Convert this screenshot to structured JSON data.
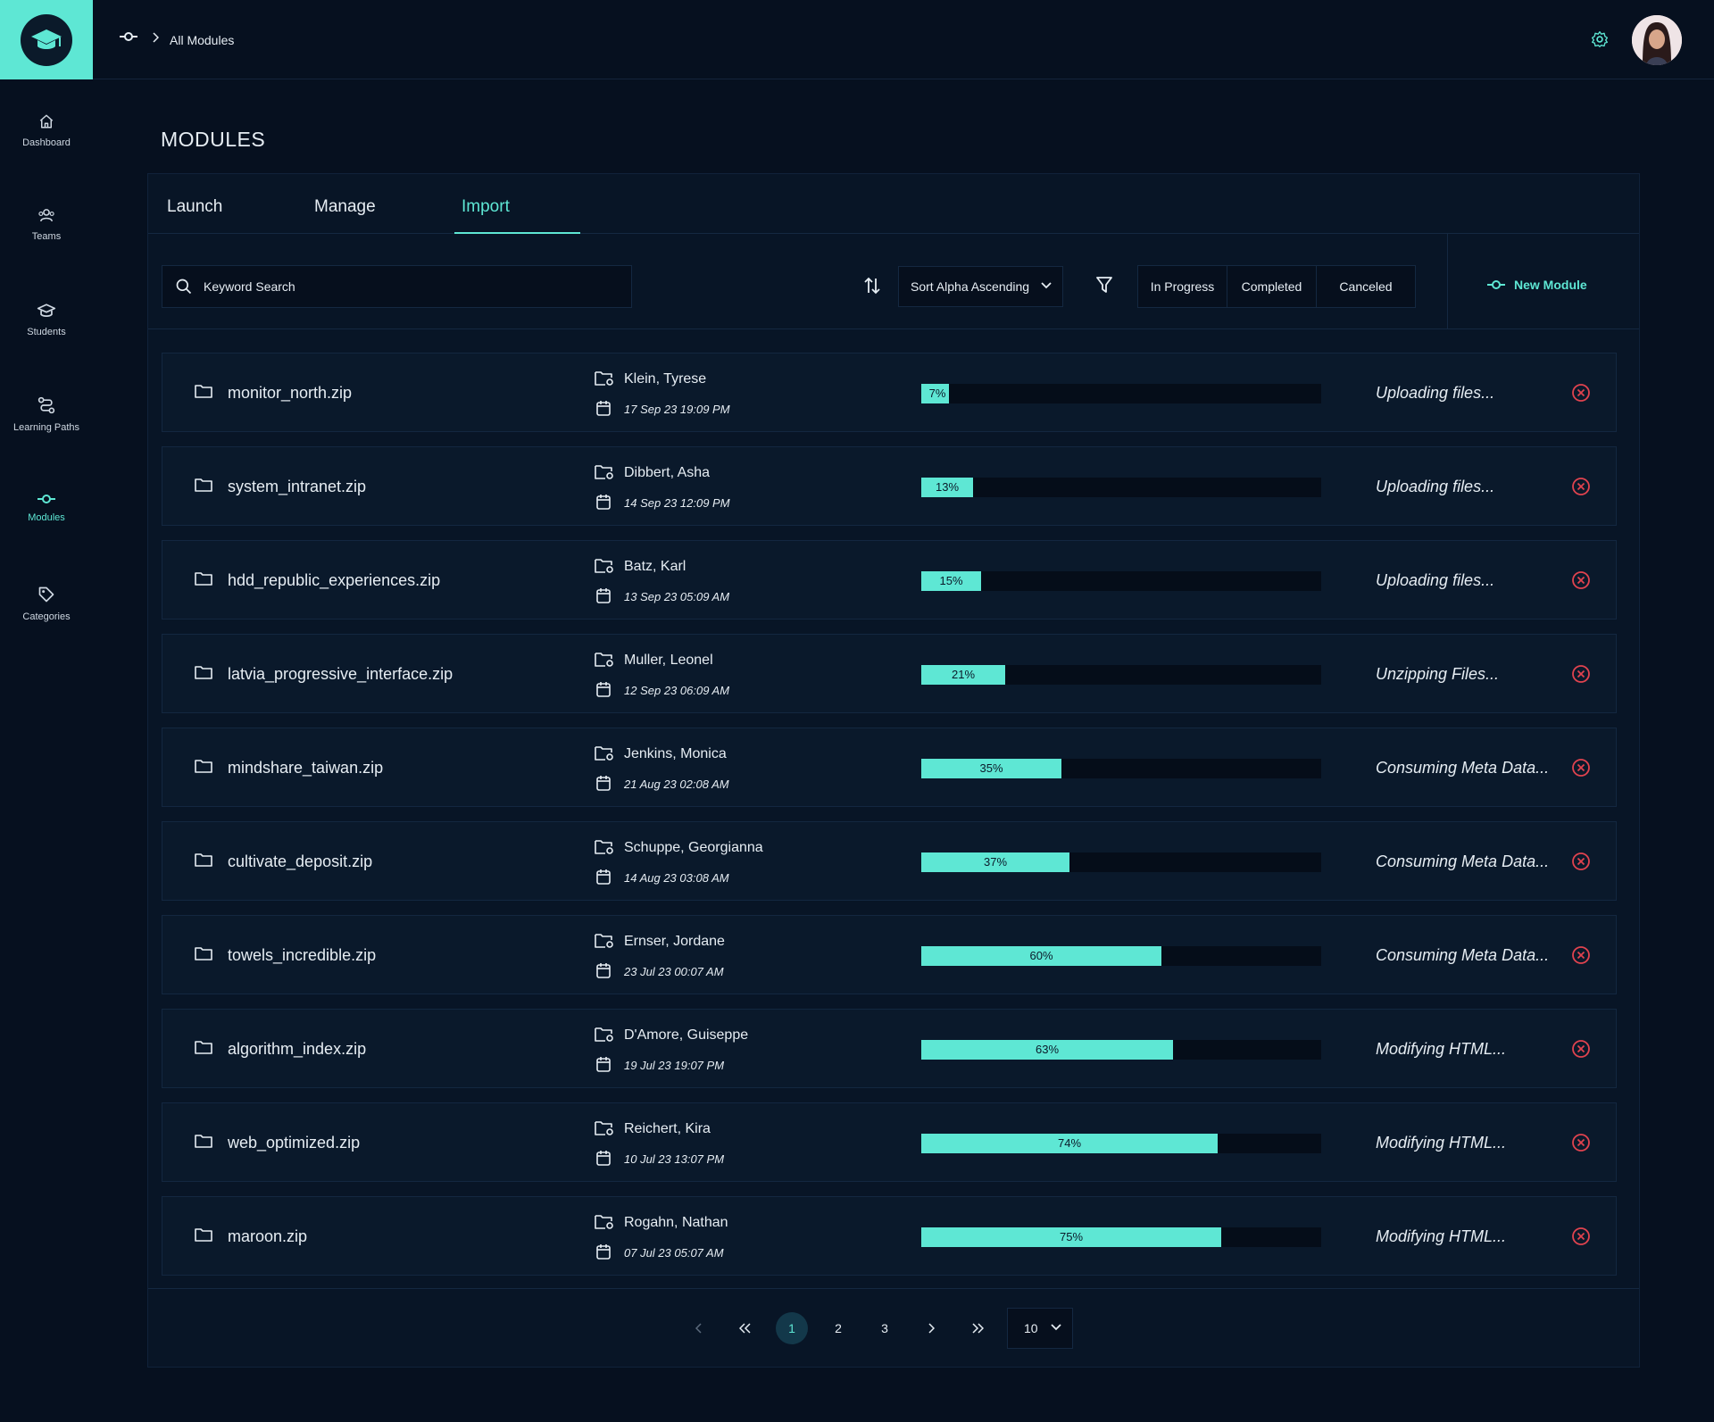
{
  "app": {
    "accent": "#5ee7d4",
    "danger": "#e0434f",
    "logo_icon": "graduation-cap-icon"
  },
  "breadcrumb": {
    "label": "All Modules"
  },
  "sidebar": {
    "items": [
      {
        "label": "Dashboard",
        "icon": "home-icon"
      },
      {
        "label": "Teams",
        "icon": "team-icon"
      },
      {
        "label": "Students",
        "icon": "graduation-cap-icon"
      },
      {
        "label": "Learning Paths",
        "icon": "path-icon"
      },
      {
        "label": "Modules",
        "icon": "module-icon",
        "active": true
      },
      {
        "label": "Categories",
        "icon": "tag-icon"
      }
    ]
  },
  "page": {
    "title": "MODULES"
  },
  "tabs": [
    {
      "label": "Launch"
    },
    {
      "label": "Manage"
    },
    {
      "label": "Import",
      "active": true
    }
  ],
  "toolbar": {
    "search_placeholder": "Keyword Search",
    "sort_value": "Sort Alpha Ascending",
    "filters": [
      "In Progress",
      "Completed",
      "Canceled"
    ],
    "new_module_label": "New Module"
  },
  "rows": [
    {
      "file": "monitor_north.zip",
      "owner": "Klein,  Tyrese",
      "date": "17 Sep 23 19:09 PM",
      "progress": 7,
      "progress_label": "7%",
      "status": "Uploading files..."
    },
    {
      "file": "system_intranet.zip",
      "owner": "Dibbert,  Asha",
      "date": "14 Sep 23 12:09 PM",
      "progress": 13,
      "progress_label": "13%",
      "status": "Uploading files..."
    },
    {
      "file": "hdd_republic_experiences.zip",
      "owner": "Batz,  Karl",
      "date": "13 Sep 23 05:09 AM",
      "progress": 15,
      "progress_label": "15%",
      "status": "Uploading files..."
    },
    {
      "file": "latvia_progressive_interface.zip",
      "owner": "Muller,  Leonel",
      "date": "12 Sep 23 06:09 AM",
      "progress": 21,
      "progress_label": "21%",
      "status": "Unzipping Files..."
    },
    {
      "file": "mindshare_taiwan.zip",
      "owner": "Jenkins,  Monica",
      "date": "21 Aug 23 02:08 AM",
      "progress": 35,
      "progress_label": "35%",
      "status": "Consuming Meta Data..."
    },
    {
      "file": "cultivate_deposit.zip",
      "owner": "Schuppe,  Georgianna",
      "date": "14 Aug 23 03:08 AM",
      "progress": 37,
      "progress_label": "37%",
      "status": "Consuming Meta Data..."
    },
    {
      "file": "towels_incredible.zip",
      "owner": "Ernser,  Jordane",
      "date": "23 Jul 23 00:07 AM",
      "progress": 60,
      "progress_label": "60%",
      "status": "Consuming Meta Data..."
    },
    {
      "file": "algorithm_index.zip",
      "owner": "D'Amore,  Guiseppe",
      "date": "19 Jul 23 19:07 PM",
      "progress": 63,
      "progress_label": "63%",
      "status": "Modifying HTML..."
    },
    {
      "file": "web_optimized.zip",
      "owner": "Reichert,  Kira",
      "date": "10 Jul 23 13:07 PM",
      "progress": 74,
      "progress_label": "74%",
      "status": "Modifying HTML..."
    },
    {
      "file": "maroon.zip",
      "owner": "Rogahn,  Nathan",
      "date": "07 Jul 23 05:07 AM",
      "progress": 75,
      "progress_label": "75%",
      "status": "Modifying HTML..."
    }
  ],
  "pagination": {
    "pages": [
      "1",
      "2",
      "3"
    ],
    "current": "1",
    "page_size": "10"
  }
}
